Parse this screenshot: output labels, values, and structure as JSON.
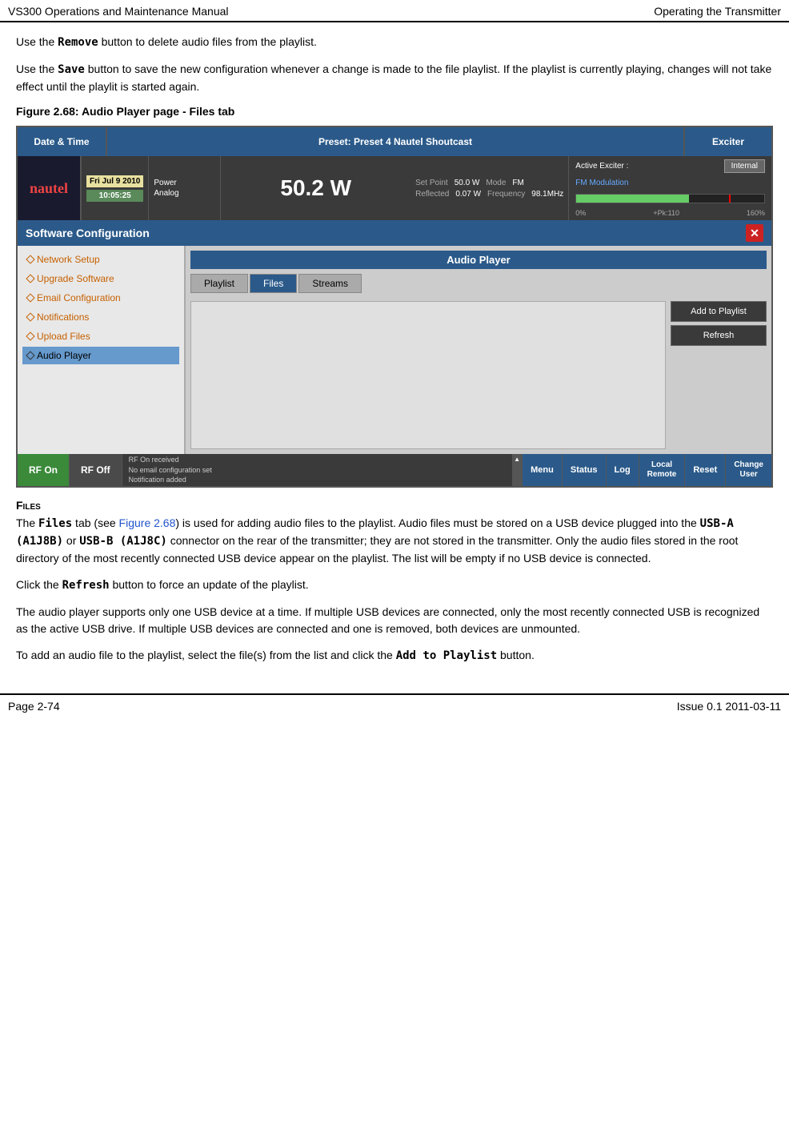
{
  "header": {
    "left": "VS300 Operations and Maintenance Manual",
    "right": "Operating the Transmitter"
  },
  "content": {
    "para1": "Use the Remove button to delete audio files from the playlist.",
    "para2": "Use the Save button to save the new configuration whenever a change is made to the file playlist. If the playlist is currently playing, changes will not take effect until the playlit is started again.",
    "figure_title": "Figure 2.68: Audio Player page - Files tab",
    "ui": {
      "topbar": {
        "date_time_label": "Date & Time",
        "preset_label": "Preset: Preset 4 Nautel Shoutcast",
        "exciter_label": "Exciter"
      },
      "statusbar": {
        "logo": "nautel",
        "date": "Fri Jul 9 2010",
        "time": "10:05:25",
        "power_type": "Power",
        "power_mode": "Analog",
        "power_big": "50.2 W",
        "setpoint_label": "Set Point",
        "setpoint_val": "50.0 W",
        "mode_label": "Mode",
        "mode_val": "FM",
        "reflected_label": "Reflected",
        "reflected_val": "0.07 W",
        "freq_label": "Frequency",
        "freq_val": "98.1MHz",
        "active_exciter": "Active Exciter :",
        "exciter_mode": "Internal",
        "fm_mod_label": "FM Modulation",
        "mod_bar_left": "0%",
        "mod_bar_right": "160%",
        "mod_bar_marker": "+Pk:110"
      },
      "software_config": {
        "title": "Software Configuration",
        "close_label": "✕"
      },
      "sidebar": {
        "items": [
          {
            "label": "Network Setup",
            "active": false
          },
          {
            "label": "Upgrade Software",
            "active": false
          },
          {
            "label": "Email Configuration",
            "active": false
          },
          {
            "label": "Notifications",
            "active": false
          },
          {
            "label": "Upload Files",
            "active": false
          },
          {
            "label": "Audio Player",
            "active": true
          }
        ]
      },
      "right_panel": {
        "title": "Audio Player",
        "tabs": [
          {
            "label": "Playlist",
            "active": false
          },
          {
            "label": "Files",
            "active": true
          },
          {
            "label": "Streams",
            "active": false
          }
        ],
        "buttons": [
          {
            "label": "Add to Playlist"
          },
          {
            "label": "Refresh"
          }
        ]
      },
      "bottombar": {
        "rf_on": "RF On",
        "rf_off": "RF Off",
        "log_lines": [
          "RF On received",
          "No email configuration set",
          "Notification added"
        ],
        "nav_buttons": [
          {
            "label": "Menu"
          },
          {
            "label": "Status"
          },
          {
            "label": "Log"
          },
          {
            "label": "Local\nRemote",
            "multiline": true
          },
          {
            "label": "Reset"
          },
          {
            "label": "Change\nUser",
            "multiline": true
          }
        ]
      }
    },
    "files_section_heading": "Files",
    "files_para1": "The Files tab (see Figure 2.68) is used for adding audio files to the playlist. Audio files must be stored on a USB device plugged into the USB-A (A1J8B) or USB-B (A1J8C) connector on the rear of the transmitter; they are not stored in the transmitter. Only the audio files stored in the root directory of the most recently connected USB device appear on the playlist. The list will be empty if no USB device is connected.",
    "files_para2": "Click the Refresh button to force an update of the playlist.",
    "files_para3": "The audio player supports only one USB device at a time. If multiple USB devices are connected, only the most recently connected USB is recognized as the active USB drive. If multiple USB devices are connected and one is removed, both devices are unmounted.",
    "files_para4": "To add an audio file to the playlist, select the file(s) from the list and click the Add to Playlist button."
  },
  "footer": {
    "left": "Page 2-74",
    "right": "Issue 0.1  2011-03-11"
  }
}
